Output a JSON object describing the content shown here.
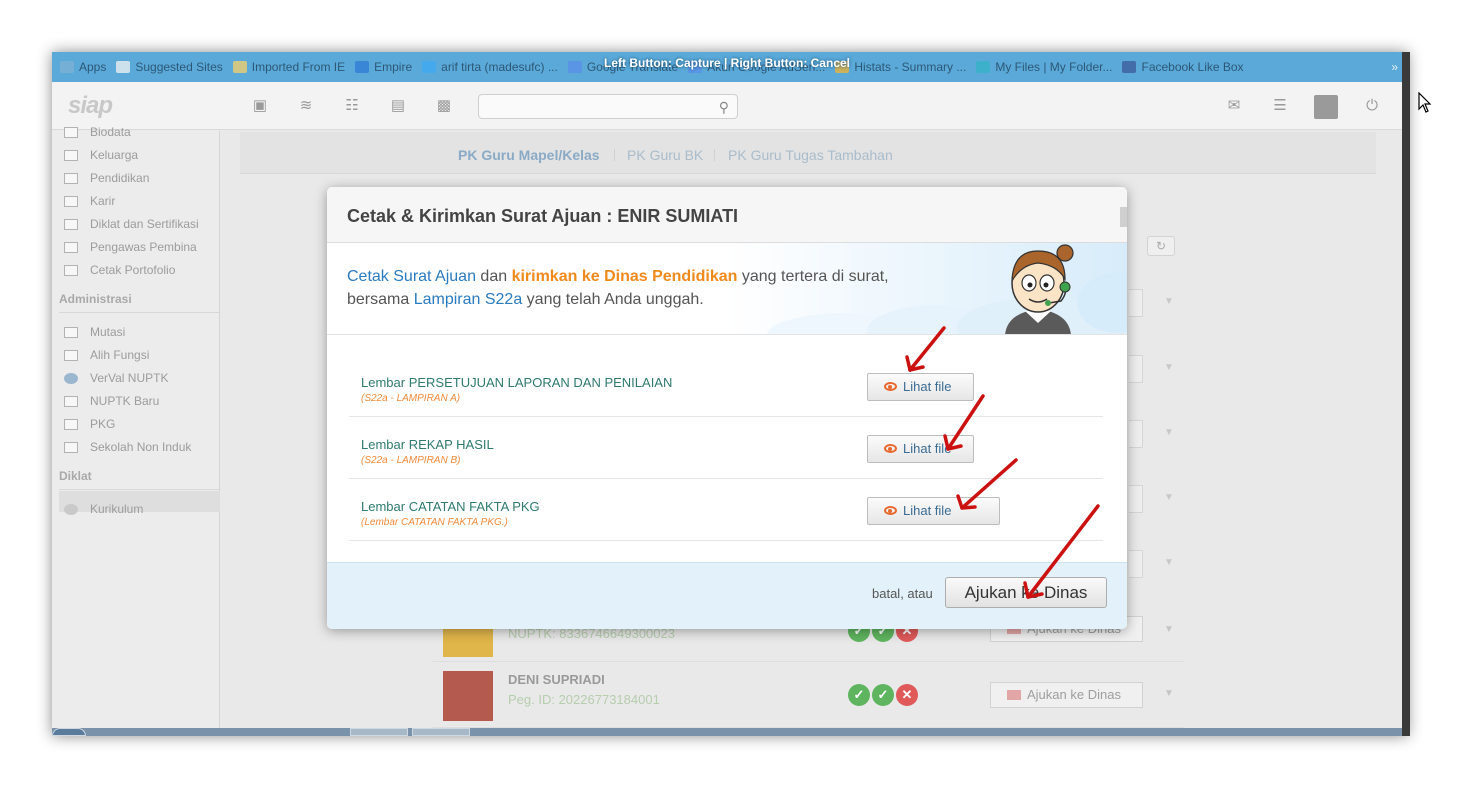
{
  "browser": {
    "bookmarks": [
      {
        "label": "Apps",
        "color": "#7fb2d6"
      },
      {
        "label": "Suggested Sites",
        "color": "#f4f4f4"
      },
      {
        "label": "Imported From IE",
        "color": "#f7d26a"
      },
      {
        "label": "Empire",
        "color": "#2f7bd6"
      },
      {
        "label": "arif tirta (madesufc) ...",
        "color": "#3fa9f5"
      },
      {
        "label": "Google Translate",
        "color": "#5b8ee8"
      },
      {
        "label": "Akun Google AdSen...",
        "color": "#5b8ee8"
      },
      {
        "label": "Histats - Summary ...",
        "color": "#f2b632"
      },
      {
        "label": "My Files | My Folder...",
        "color": "#34b3c9"
      },
      {
        "label": "Facebook Like Box",
        "color": "#3b5998"
      }
    ],
    "more": "»",
    "capture_banner": "Left Button: Capture | Right Button: Cancel"
  },
  "app": {
    "logo": "siap",
    "header_icons": [
      "cube-icon",
      "rss-icon",
      "binoculars-icon",
      "document-icon",
      "contact-card-icon"
    ],
    "right_icons": [
      "mail-icon",
      "list-icon",
      "avatar",
      "power-icon"
    ],
    "search_placeholder": ""
  },
  "sidebar": {
    "items_top": [
      {
        "label": "Biodata"
      },
      {
        "label": "Keluarga"
      },
      {
        "label": "Pendidikan"
      },
      {
        "label": "Karir"
      },
      {
        "label": "Diklat dan Sertifikasi"
      },
      {
        "label": "Pengawas Pembina"
      },
      {
        "label": "Cetak Portofolio"
      }
    ],
    "section_admin": "Administrasi",
    "items_admin": [
      {
        "label": "Mutasi"
      },
      {
        "label": "Alih Fungsi"
      },
      {
        "label": "VerVal NUPTK"
      },
      {
        "label": "NUPTK Baru"
      },
      {
        "label": "PKG"
      },
      {
        "label": "Sekolah Non Induk"
      }
    ],
    "section_diklat": "Diklat",
    "items_diklat": [
      {
        "label": "Kurikulum"
      }
    ]
  },
  "content": {
    "tabs": [
      "PK Guru Mapel/Kelas",
      "PK Guru BK",
      "PK Guru Tugas Tambahan"
    ],
    "rows": [
      {
        "name": "",
        "id": "NUPTK: 8336746649300023",
        "action": "Ajukan ke Dinas"
      },
      {
        "name": "DENI SUPRIADI",
        "id": "Peg. ID: 20226773184001",
        "action": "Ajukan ke Dinas"
      }
    ]
  },
  "modal": {
    "title": "Cetak & Kirimkan Surat Ajuan : ENIR SUMIATI",
    "intro": {
      "part1": "Cetak Surat Ajuan",
      "part2": " dan ",
      "part3": "kirimkan ke Dinas Pendidikan",
      "part4": " yang tertera di surat,",
      "part5": "bersama ",
      "part6": "Lampiran S22a",
      "part7": " yang telah Anda unggah."
    },
    "documents": [
      {
        "name": "Lembar PERSETUJUAN LAPORAN DAN PENILAIAN",
        "sub": "(S22a - LAMPIRAN A)",
        "button": "Lihat file"
      },
      {
        "name": "Lembar REKAP HASIL",
        "sub": "(S22a - LAMPIRAN B)",
        "button": "Lihat file"
      },
      {
        "name": "Lembar CATATAN FAKTA PKG",
        "sub": "(Lembar CATATAN FAKTA PKG.)",
        "button": "Lihat file"
      }
    ],
    "footer": {
      "cancel_text": "batal, atau",
      "submit": "Ajukan ke Dinas"
    }
  },
  "colors": {
    "accent_blue": "#2b7bbf",
    "accent_orange": "#f08a1d",
    "annotation_red": "#cc1111"
  }
}
